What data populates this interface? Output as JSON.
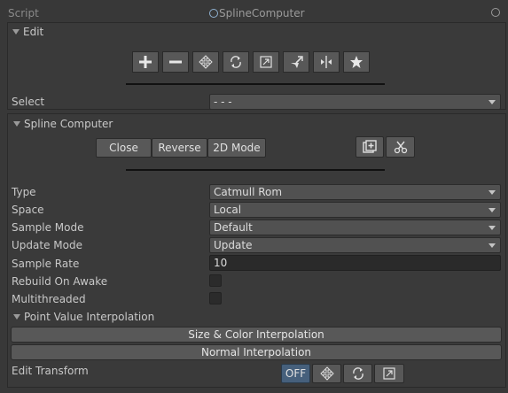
{
  "script_row": {
    "label": "Script",
    "value": "SplineComputer"
  },
  "edit": {
    "title": "Edit",
    "tools": [
      "add-tool",
      "remove-tool",
      "move-tool",
      "rotate-tool",
      "scale-tool",
      "normal-tool",
      "mirror-tool",
      "merge-tool"
    ],
    "select_label": "Select",
    "select_value": "- - -"
  },
  "spline": {
    "title": "Spline Computer",
    "buttons": {
      "close": "Close",
      "reverse": "Reverse",
      "mode2d": "2D Mode"
    },
    "icons": [
      "frame-icon",
      "scissors-icon"
    ],
    "fields": {
      "type": {
        "label": "Type",
        "value": "Catmull Rom"
      },
      "space": {
        "label": "Space",
        "value": "Local"
      },
      "sample_mode": {
        "label": "Sample Mode",
        "value": "Default"
      },
      "update_mode": {
        "label": "Update Mode",
        "value": "Update"
      },
      "sample_rate": {
        "label": "Sample Rate",
        "value": "10"
      },
      "rebuild_on_awake": {
        "label": "Rebuild On Awake",
        "checked": false
      },
      "multithreaded": {
        "label": "Multithreaded",
        "checked": false
      }
    },
    "interp": {
      "title": "Point Value Interpolation",
      "size_color_button": "Size & Color Interpolation",
      "normal_button": "Normal Interpolation"
    },
    "edit_transform": {
      "label": "Edit Transform",
      "off_label": "OFF",
      "selected": "OFF"
    }
  },
  "colors": {
    "background": "#383838",
    "selected_toggle": "#46607c"
  }
}
